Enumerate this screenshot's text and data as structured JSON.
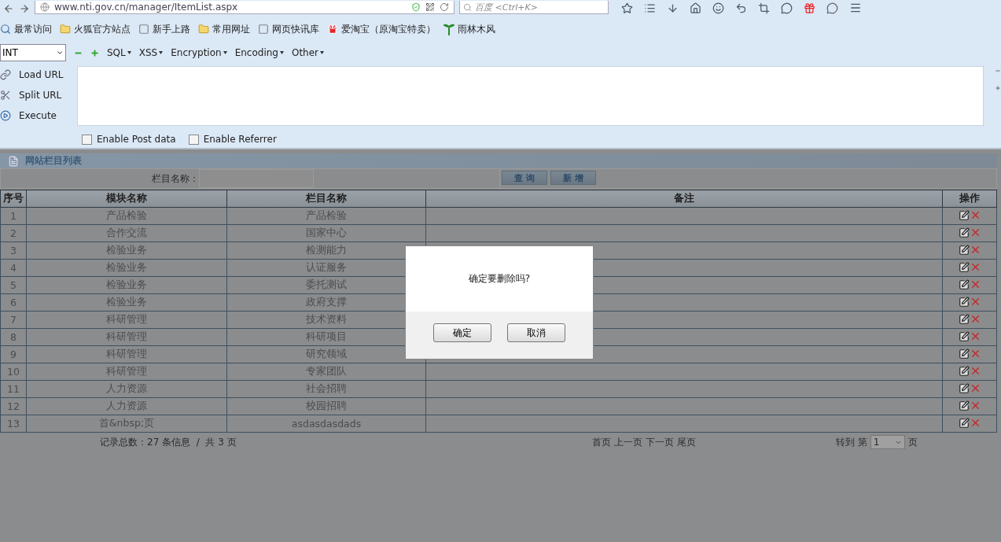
{
  "browser": {
    "url": "www.nti.gov.cn/manager/ItemList.aspx",
    "search_placeholder": "百度 <Ctrl+K>",
    "bookmarks": [
      {
        "label": "最常访问",
        "kind": "search"
      },
      {
        "label": "火狐官方站点",
        "kind": "folder"
      },
      {
        "label": "新手上路",
        "kind": "page"
      },
      {
        "label": "常用网址",
        "kind": "folder"
      },
      {
        "label": "网页快讯库",
        "kind": "page"
      },
      {
        "label": "爱淘宝（原淘宝特卖）",
        "kind": "taobao"
      },
      {
        "label": "雨林木风",
        "kind": "tree"
      }
    ]
  },
  "hackbar": {
    "select_value": "INT",
    "menus": [
      "SQL",
      "XSS",
      "Encryption",
      "Encoding",
      "Other"
    ],
    "actions": [
      {
        "label": "Load URL",
        "kind": "load"
      },
      {
        "label": "Split URL",
        "kind": "split"
      },
      {
        "label": "Execute",
        "kind": "execute"
      }
    ],
    "checkboxes": [
      {
        "label": "Enable Post data",
        "checked": false
      },
      {
        "label": "Enable Referrer",
        "checked": false
      }
    ]
  },
  "page": {
    "panel_title": "网站栏目列表",
    "filter_label": "栏目名称：",
    "buttons": [
      "查 询",
      "新 增"
    ],
    "columns": [
      "序号",
      "模块名称",
      "栏目名称",
      "备注",
      "操作"
    ],
    "rows": [
      [
        "1",
        "产品检验",
        "产品检验"
      ],
      [
        "2",
        "合作交流",
        "国家中心"
      ],
      [
        "3",
        "检验业务",
        "检测能力"
      ],
      [
        "4",
        "检验业务",
        "认证服务"
      ],
      [
        "5",
        "检验业务",
        "委托测试"
      ],
      [
        "6",
        "检验业务",
        "政府支撑"
      ],
      [
        "7",
        "科研管理",
        "技术资料"
      ],
      [
        "8",
        "科研管理",
        "科研项目"
      ],
      [
        "9",
        "科研管理",
        "研究领域"
      ],
      [
        "10",
        "科研管理",
        "专家团队"
      ],
      [
        "11",
        "人力资源",
        "社会招聘"
      ],
      [
        "12",
        "人力资源",
        "校园招聘"
      ],
      [
        "13",
        "首&nbsp;页",
        "asdasdasdads"
      ]
    ],
    "footer": {
      "records": "记录总数：27 条信息  /  共 3 页",
      "pager": [
        "首页",
        "上一页",
        "下一页",
        "尾页"
      ],
      "goto_label": "转到 第",
      "goto_value": "1",
      "goto_suffix": "页"
    },
    "dialog": {
      "message": "确定要删除吗?",
      "buttons": [
        "确定",
        "取消"
      ]
    }
  }
}
